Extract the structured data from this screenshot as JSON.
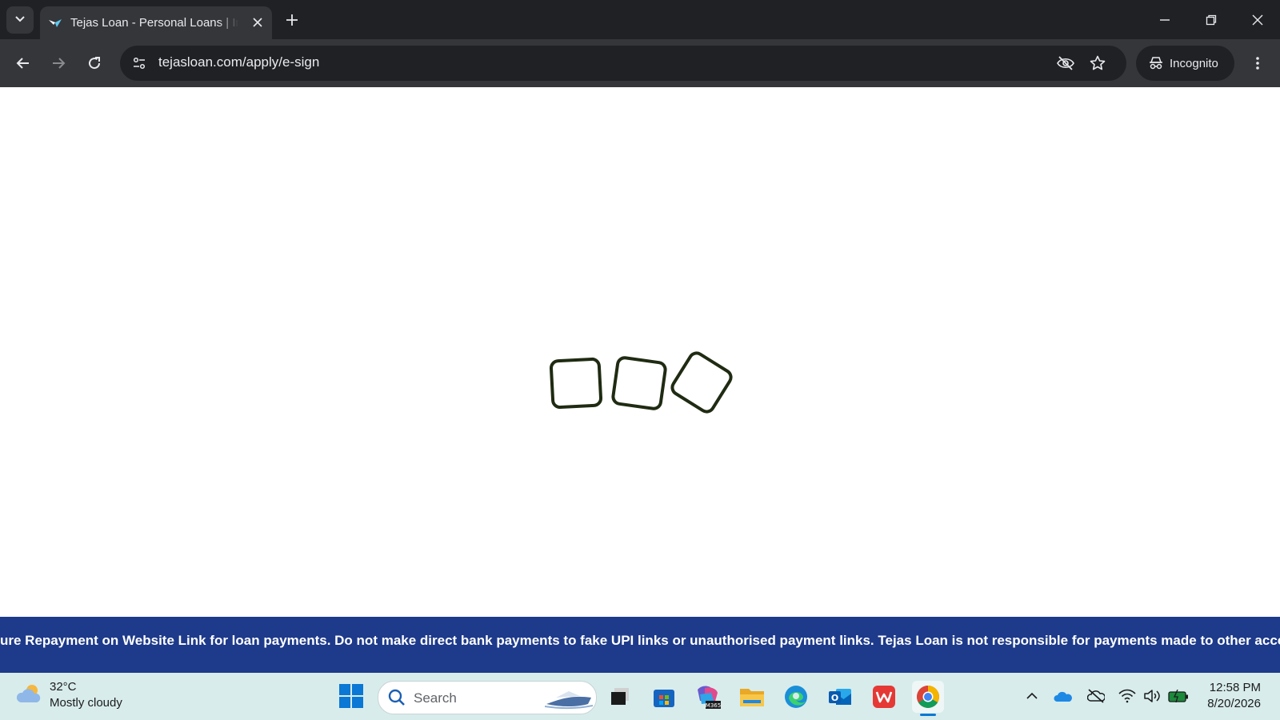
{
  "browser": {
    "tab_title": "Tejas Loan - Personal Loans | Instant Personal Loan Online",
    "url": "tejasloan.com/apply/e-sign",
    "incognito_label": "Incognito"
  },
  "banner": {
    "text": "ure Repayment on Website Link for loan payments. Do not make direct bank payments to fake UPI links or unauthorised payment links. Tejas Loan is not responsible for payments made to other accounts"
  },
  "taskbar": {
    "weather_temp": "32°C",
    "weather_desc": "Mostly cloudy",
    "search_label": "Search",
    "time": "12:58 PM",
    "date": "8/20/2026"
  },
  "colors": {
    "banner_bg": "#1e3a8a",
    "loader_stroke": "#1f2b12",
    "chrome_dark": "#202124",
    "chrome_toolbar": "#35363a"
  },
  "icons": [
    "tab-search-icon",
    "favicon-icon",
    "close-icon",
    "plus-icon",
    "minimize-icon",
    "restore-icon",
    "window-close-icon",
    "back-icon",
    "forward-icon",
    "reload-icon",
    "site-info-icon",
    "eye-off-icon",
    "star-icon",
    "incognito-icon",
    "kebab-menu-icon",
    "weather-cloud-icon",
    "windows-start-icon",
    "search-icon",
    "task-view-icon",
    "store-icon",
    "m365-icon",
    "file-explorer-icon",
    "edge-icon",
    "outlook-icon",
    "wps-icon",
    "chrome-icon",
    "chevron-up-icon",
    "onedrive-icon",
    "sync-off-icon",
    "wifi-icon",
    "volume-icon",
    "battery-icon"
  ]
}
